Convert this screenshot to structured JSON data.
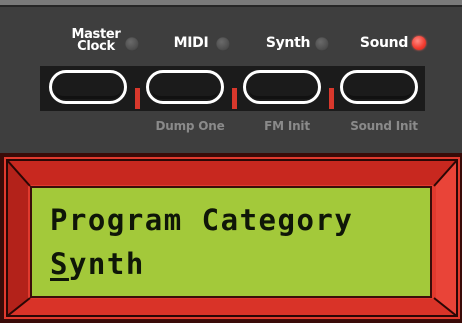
{
  "buttons": [
    {
      "label": "Master\nClock",
      "label_line1": "Master",
      "label_line2": "Clock",
      "led": "off",
      "sub_label": ""
    },
    {
      "label": "MIDI",
      "led": "off",
      "sub_label": "Dump One"
    },
    {
      "label": "Synth",
      "led": "off",
      "sub_label": "FM Init"
    },
    {
      "label": "Sound",
      "led": "on",
      "sub_label": "Sound Init"
    }
  ],
  "display": {
    "line1": "Program Category",
    "line2_cursor_char": "S",
    "line2_rest": "ynth"
  },
  "colors": {
    "panel": "#3e3e3e",
    "led_on": "#f13a2e",
    "led_off": "#5a5a5a",
    "bezel": "#e13a2e",
    "lcd_background": "#a3c93a",
    "lcd_text": "#0f1608",
    "separator": "#d8382c"
  }
}
